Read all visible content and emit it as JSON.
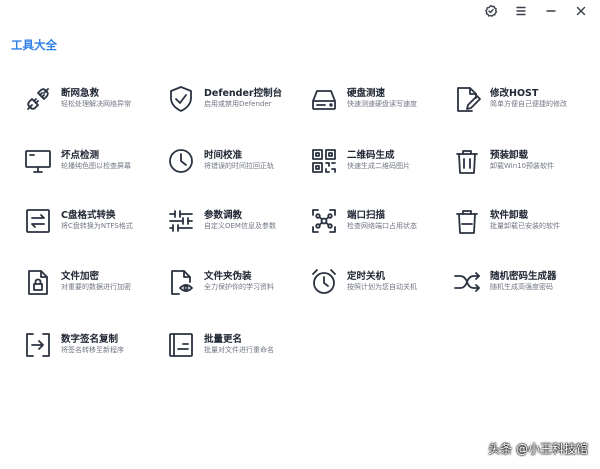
{
  "header": {
    "title": "工具大全"
  },
  "window": {
    "buttons": [
      "settings-icon",
      "menu-icon",
      "minimize-icon",
      "close-icon"
    ]
  },
  "tools": [
    {
      "name": "断网急救",
      "desc": "轻松处理解决网络异常",
      "icon": "plug-icon"
    },
    {
      "name": "Defender控制台",
      "desc": "启用或禁用Defender",
      "icon": "shield-check-icon"
    },
    {
      "name": "硬盘测速",
      "desc": "快速测速硬盘读写速度",
      "icon": "hard-drive-icon"
    },
    {
      "name": "修改HOST",
      "desc": "简单方便自己便捷的修改",
      "icon": "edit-file-icon"
    },
    {
      "name": "坏点检测",
      "desc": "轮播纯色图以检查屏幕",
      "icon": "monitor-icon"
    },
    {
      "name": "时间校准",
      "desc": "将错误的时间拉回正轨",
      "icon": "clock-icon"
    },
    {
      "name": "二维码生成",
      "desc": "快速生成二维码图片",
      "icon": "qrcode-icon"
    },
    {
      "name": "预装卸载",
      "desc": "卸载Win10预装软件",
      "icon": "trash-icon"
    },
    {
      "name": "C盘格式转换",
      "desc": "将C盘转换为NTFS格式",
      "icon": "swap-icon"
    },
    {
      "name": "参数调教",
      "desc": "自定义OEM信息及参数",
      "icon": "sliders-icon"
    },
    {
      "name": "端口扫描",
      "desc": "检查网络端口占用状态",
      "icon": "scan-network-icon"
    },
    {
      "name": "软件卸载",
      "desc": "批量卸载已安装的软件",
      "icon": "trash-icon"
    },
    {
      "name": "文件加密",
      "desc": "对重要的数据进行加密",
      "icon": "lock-file-icon"
    },
    {
      "name": "文件夹伪装",
      "desc": "全力保护你的学习资料",
      "icon": "folder-disguise-icon"
    },
    {
      "name": "定时关机",
      "desc": "按照计划为您自动关机",
      "icon": "alarm-clock-icon"
    },
    {
      "name": "随机密码生成器",
      "desc": "随机生成高强度密码",
      "icon": "shuffle-icon"
    },
    {
      "name": "数字签名复制",
      "desc": "将签名转移至新程序",
      "icon": "signature-copy-icon"
    },
    {
      "name": "批量更名",
      "desc": "批量对文件进行重命名",
      "icon": "rename-icon"
    }
  ],
  "watermark": "头条 @小王科技馆"
}
